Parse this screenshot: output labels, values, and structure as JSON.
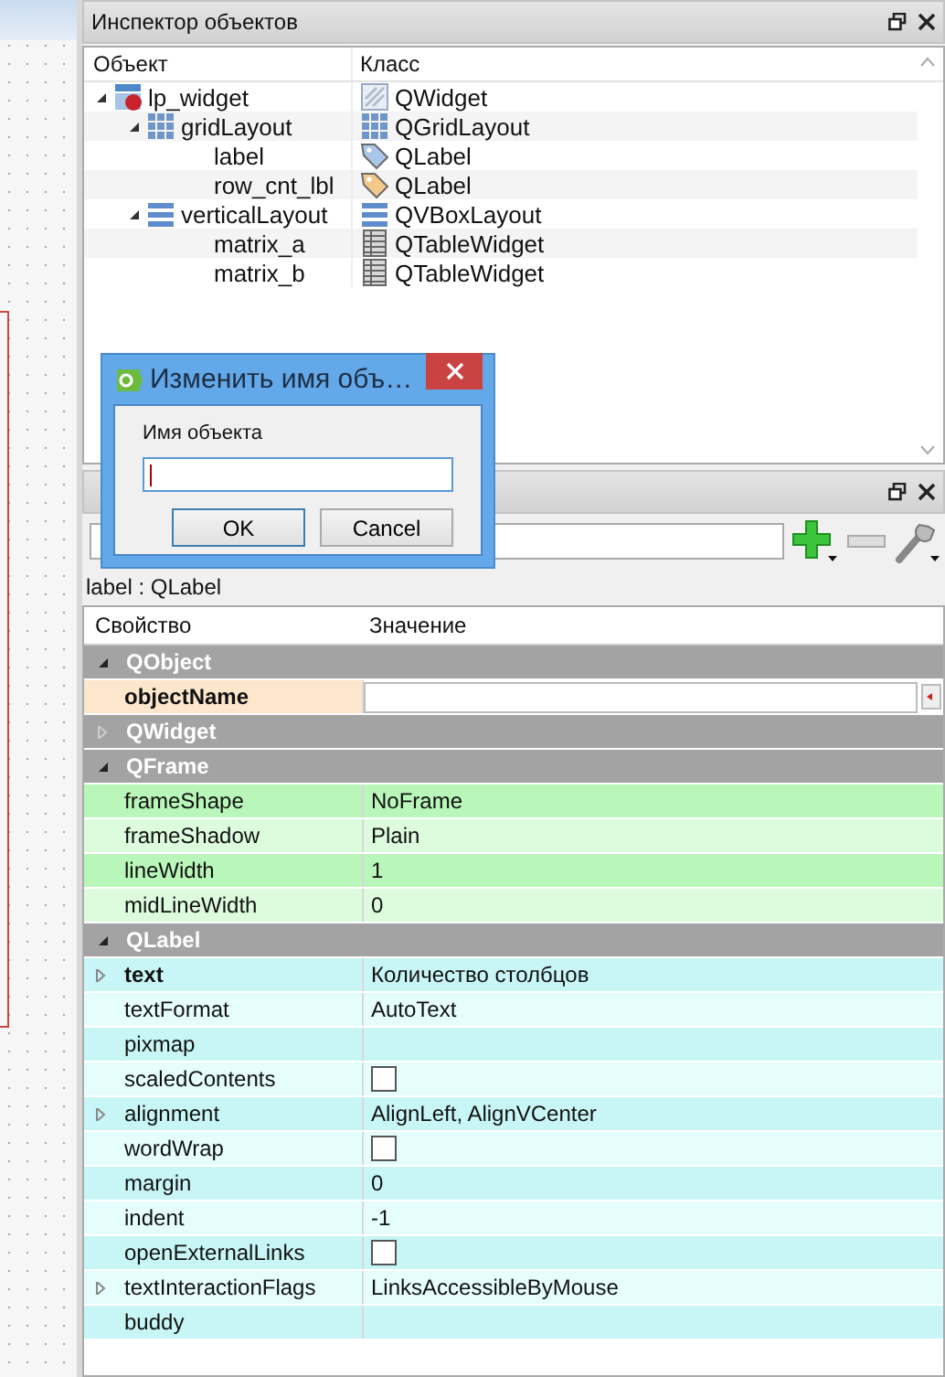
{
  "object_inspector": {
    "title": "Инспектор объектов",
    "columns": [
      "Объект",
      "Класс"
    ],
    "tree": [
      {
        "name": "lp_widget",
        "class": "QWidget",
        "kind": "widget",
        "expanded": true,
        "children": [
          {
            "name": "gridLayout",
            "class": "QGridLayout",
            "kind": "grid",
            "expanded": true,
            "children": [
              {
                "name": "label",
                "class": "QLabel",
                "kind": "label"
              },
              {
                "name": "row_cnt_lbl",
                "class": "QLabel",
                "kind": "label"
              }
            ]
          },
          {
            "name": "verticalLayout",
            "class": "QVBoxLayout",
            "kind": "vbox",
            "expanded": true,
            "children": [
              {
                "name": "matrix_a",
                "class": "QTableWidget",
                "kind": "table"
              },
              {
                "name": "matrix_b",
                "class": "QTableWidget",
                "kind": "table"
              }
            ]
          }
        ]
      }
    ]
  },
  "property_editor": {
    "subject": "label : QLabel",
    "columns": [
      "Свойство",
      "Значение"
    ],
    "sections": [
      {
        "name": "QObject",
        "expanded": true,
        "rows": [
          {
            "name": "objectName",
            "kind": "edit",
            "modified": true
          }
        ]
      },
      {
        "name": "QWidget",
        "expanded": false
      },
      {
        "name": "QFrame",
        "expanded": true,
        "rows": [
          {
            "name": "frameShape",
            "kind": "text",
            "value": "NoFrame"
          },
          {
            "name": "frameShadow",
            "kind": "text",
            "value": "Plain"
          },
          {
            "name": "lineWidth",
            "kind": "text",
            "value": "1"
          },
          {
            "name": "midLineWidth",
            "kind": "text",
            "value": "0"
          }
        ]
      },
      {
        "name": "QLabel",
        "expanded": true,
        "rows": [
          {
            "name": "text",
            "kind": "text",
            "value": "Количество столбцов",
            "modified": true,
            "expandable": true
          },
          {
            "name": "textFormat",
            "kind": "text",
            "value": "AutoText"
          },
          {
            "name": "pixmap",
            "kind": "empty"
          },
          {
            "name": "scaledContents",
            "kind": "checkbox",
            "checked": false
          },
          {
            "name": "alignment",
            "kind": "text",
            "value": "AlignLeft, AlignVCenter",
            "expandable": true
          },
          {
            "name": "wordWrap",
            "kind": "checkbox",
            "checked": false
          },
          {
            "name": "margin",
            "kind": "text",
            "value": "0"
          },
          {
            "name": "indent",
            "kind": "text",
            "value": "-1"
          },
          {
            "name": "openExternalLinks",
            "kind": "checkbox",
            "checked": false
          },
          {
            "name": "textInteractionFlags",
            "kind": "text",
            "value": "LinksAccessibleByMouse",
            "expandable": true
          },
          {
            "name": "buddy",
            "kind": "empty"
          }
        ]
      }
    ]
  },
  "dialog": {
    "title": "Изменить имя объ…",
    "label": "Имя объекта",
    "buttons": [
      {
        "label": "OK",
        "default": true
      },
      {
        "label": "Cancel",
        "default": false
      }
    ]
  }
}
